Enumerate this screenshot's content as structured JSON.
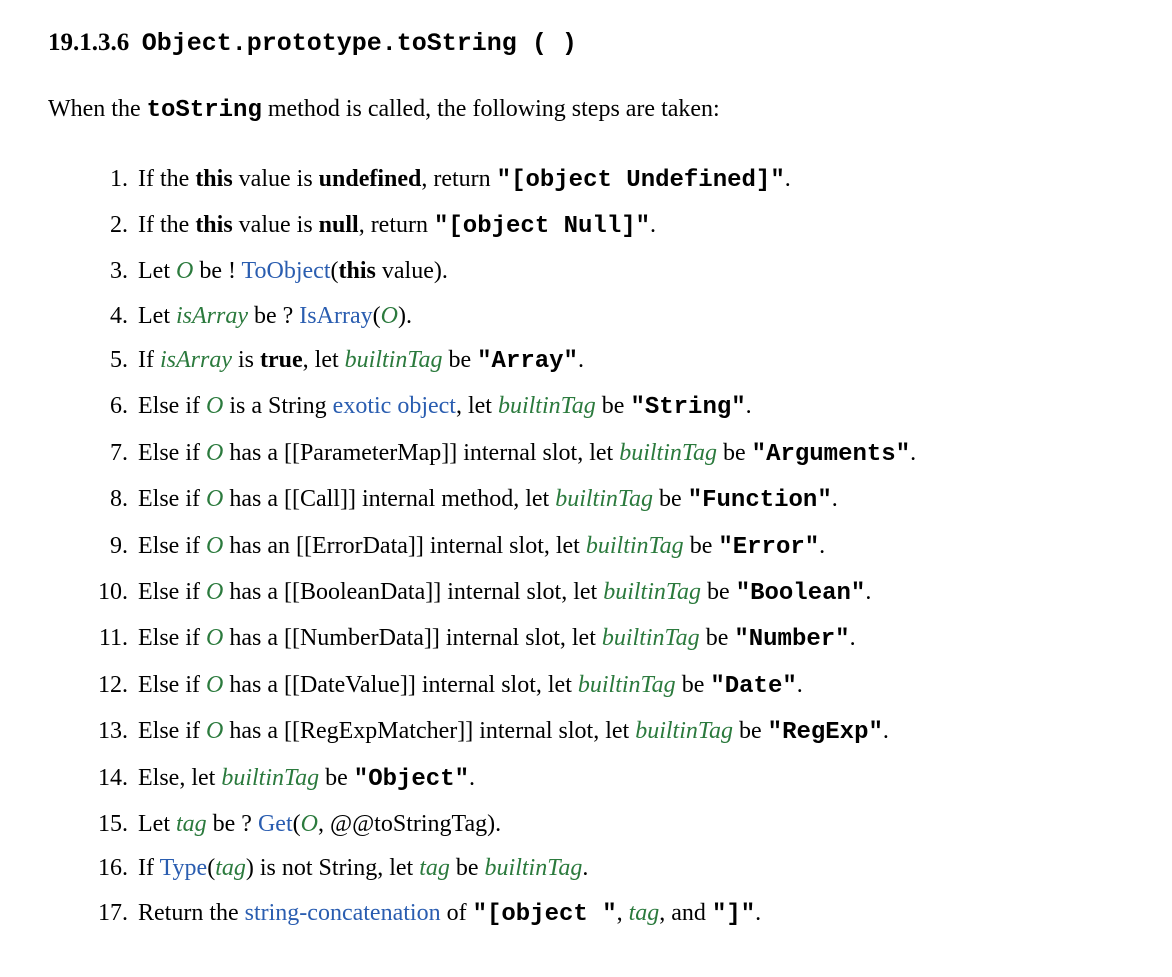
{
  "section": {
    "number": "19.1.3.6",
    "title_plain": "Object.prototype.toString ( )"
  },
  "intro": {
    "prefix": "When the ",
    "method": "toString",
    "suffix": " method is called, the following steps are taken:"
  },
  "tokens": {
    "this": "this",
    "undefined": "undefined",
    "null": "null",
    "true": "true",
    "O": "O",
    "isArray": "isArray",
    "builtinTag": "builtinTag",
    "tag": "tag",
    "ToObject": "ToObject",
    "IsArray": "IsArray",
    "exotic_object": "exotic object",
    "Get": "Get",
    "Type": "Type",
    "string_concatenation": "string-concatenation",
    "at_toStringTag": "@@toStringTag"
  },
  "codes": {
    "obj_undefined": "\"[object Undefined]\"",
    "obj_null": "\"[object Null]\"",
    "Array": "\"Array\"",
    "String": "\"String\"",
    "Arguments": "\"Arguments\"",
    "Function": "\"Function\"",
    "Error": "\"Error\"",
    "Boolean": "\"Boolean\"",
    "Number": "\"Number\"",
    "Date": "\"Date\"",
    "RegExp": "\"RegExp\"",
    "Object": "\"Object\"",
    "bracket_open": "\"[object \"",
    "bracket_close": "\"]\""
  },
  "text": {
    "s1_a": "If the ",
    "s1_b": " value is ",
    "s1_c": ", return ",
    "s2_a": "If the ",
    "s2_b": " value is ",
    "s2_c": ", return ",
    "s3_a": "Let ",
    "s3_b": " be ! ",
    "s3_c": " value).",
    "s4_a": "Let ",
    "s4_b": " be ? ",
    "s5_a": "If ",
    "s5_b": " is ",
    "s5_c": ", let ",
    "s5_d": " be ",
    "s6_a": "Else if ",
    "s6_b": " is a String ",
    "s6_c": ", let ",
    "s6_d": " be ",
    "s7_a": "Else if ",
    "s7_slot": " has a [[ParameterMap]] internal slot, let ",
    "s7_d": " be ",
    "s8_a": "Else if ",
    "s8_slot": " has a [[Call]] internal method, let ",
    "s8_d": " be ",
    "s9_a": "Else if ",
    "s9_slot": " has an [[ErrorData]] internal slot, let ",
    "s9_d": " be ",
    "s10_a": "Else if ",
    "s10_slot": " has a [[BooleanData]] internal slot, let ",
    "s10_d": " be ",
    "s11_a": "Else if ",
    "s11_slot": " has a [[NumberData]] internal slot, let ",
    "s11_d": " be ",
    "s12_a": "Else if ",
    "s12_slot": " has a [[DateValue]] internal slot, let ",
    "s12_d": " be ",
    "s13_a": "Else if ",
    "s13_slot": " has a [[RegExpMatcher]] internal slot, let ",
    "s13_d": " be ",
    "s14_a": "Else, let ",
    "s14_b": " be ",
    "s15_a": "Let ",
    "s15_b": " be ? ",
    "s16_a": "If ",
    "s16_b": ") is not String, let ",
    "s16_c": " be ",
    "s17_a": "Return the ",
    "s17_b": " of ",
    "s17_c": ", and ",
    "period": ".",
    "comma_sp": ", ",
    "open_paren": "(",
    "close_paren": ")",
    "close_paren_period": ")."
  }
}
